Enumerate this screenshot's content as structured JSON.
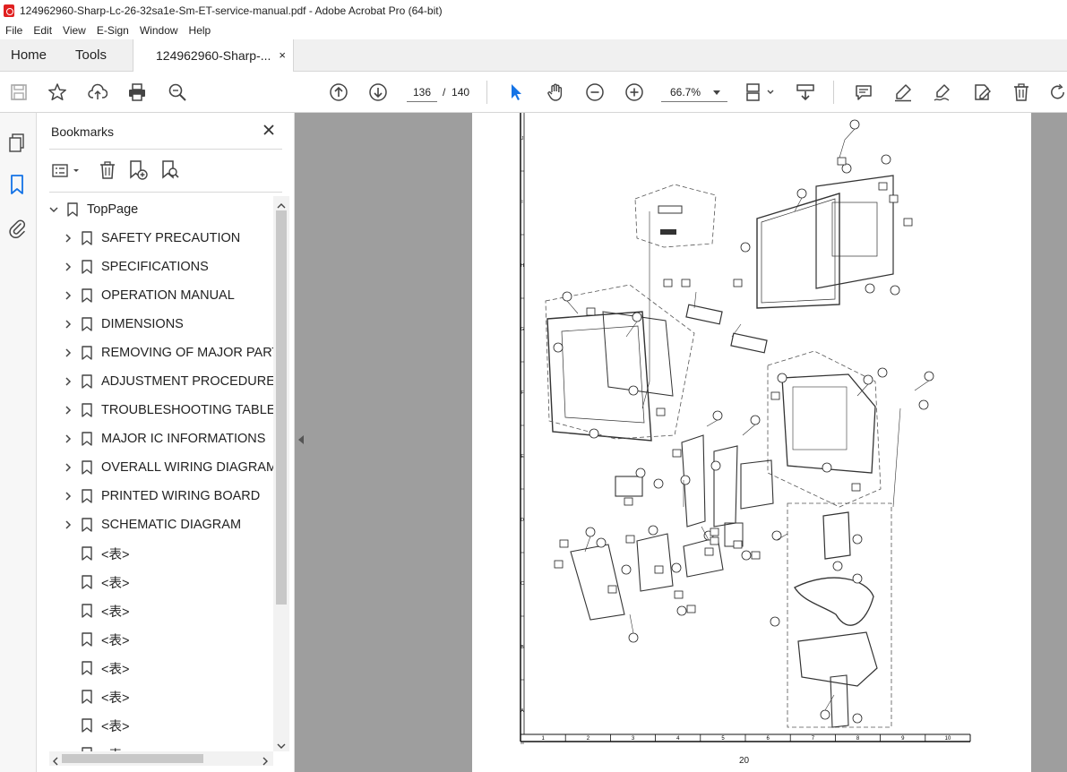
{
  "window": {
    "title": "124962960-Sharp-Lc-26-32sa1e-Sm-ET-service-manual.pdf - Adobe Acrobat Pro (64-bit)"
  },
  "menu": [
    "File",
    "Edit",
    "View",
    "E-Sign",
    "Window",
    "Help"
  ],
  "tabs": {
    "home": "Home",
    "tools": "Tools",
    "document": "124962960-Sharp-...",
    "close": "×"
  },
  "toolbar": {
    "current_page": "136",
    "page_separator": "/",
    "total_pages": "140",
    "zoom": "66.7%",
    "icons": [
      "save-icon",
      "star-icon",
      "upload-icon",
      "print-icon",
      "zoom-search-icon",
      "page-up-icon",
      "page-down-icon",
      "select-cursor-icon",
      "hand-icon",
      "zoom-out-icon",
      "zoom-in-icon",
      "fit-page-icon",
      "scroll-mode-icon",
      "comment-icon",
      "highlight-icon",
      "sign-icon",
      "edit-icon",
      "delete-icon",
      "rotate-icon"
    ],
    "accent": "#1473e6"
  },
  "bookmarks": {
    "title": "Bookmarks",
    "close": "×",
    "items": [
      {
        "label": "TopPage",
        "expander": "down",
        "level": 0
      },
      {
        "label": "SAFETY PRECAUTION",
        "expander": "right",
        "level": 1
      },
      {
        "label": "SPECIFICATIONS",
        "expander": "right",
        "level": 1
      },
      {
        "label": "OPERATION MANUAL",
        "expander": "right",
        "level": 1
      },
      {
        "label": "DIMENSIONS",
        "expander": "right",
        "level": 1
      },
      {
        "label": "REMOVING OF MAJOR PARTS",
        "expander": "right",
        "level": 1
      },
      {
        "label": "ADJUSTMENT PROCEDURE",
        "expander": "right",
        "level": 1
      },
      {
        "label": "TROUBLESHOOTING TABLE",
        "expander": "right",
        "level": 1
      },
      {
        "label": "MAJOR IC INFORMATIONS",
        "expander": "right",
        "level": 1
      },
      {
        "label": "OVERALL WIRING DIAGRAM/",
        "expander": "right",
        "level": 1
      },
      {
        "label": "PRINTED WIRING BOARD",
        "expander": "right",
        "level": 1
      },
      {
        "label": "SCHEMATIC DIAGRAM",
        "expander": "right",
        "level": 1
      },
      {
        "label": "<表>",
        "expander": "none",
        "level": 1
      },
      {
        "label": "<表>",
        "expander": "none",
        "level": 1
      },
      {
        "label": "<表>",
        "expander": "none",
        "level": 1
      },
      {
        "label": "<表>",
        "expander": "none",
        "level": 1
      },
      {
        "label": "<表>",
        "expander": "none",
        "level": 1
      },
      {
        "label": "<表>",
        "expander": "none",
        "level": 1
      },
      {
        "label": "<表>",
        "expander": "none",
        "level": 1
      },
      {
        "label": "<表>",
        "expander": "none",
        "level": 1
      }
    ]
  },
  "document": {
    "page_number": "20",
    "x_ticks": [
      "1",
      "2",
      "3",
      "4",
      "5",
      "6",
      "7",
      "8",
      "9",
      "10"
    ],
    "y_ticks": [
      "J",
      "I",
      "H",
      "G",
      "F",
      "E",
      "D",
      "C",
      "B",
      "A"
    ]
  }
}
